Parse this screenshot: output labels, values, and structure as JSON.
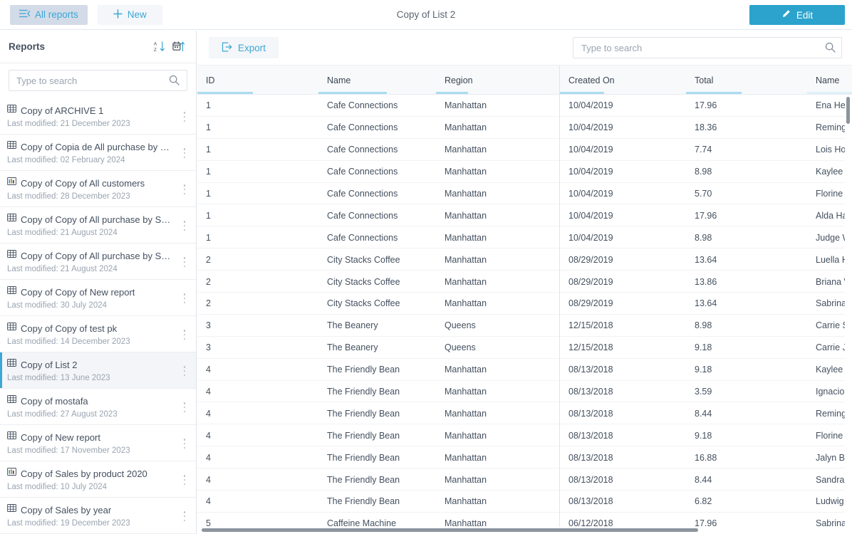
{
  "topbar": {
    "all_reports_label": "All reports",
    "new_label": "New",
    "title": "Copy of List 2",
    "edit_label": "Edit"
  },
  "sidebar": {
    "title": "Reports",
    "sort_alpha_icon": "sort-alpha-desc-icon",
    "sort_date_icon": "sort-date-asc-icon",
    "search_placeholder": "Type to search",
    "search_value": "",
    "modified_prefix": "Last modified:",
    "items": [
      {
        "icon": "table-report-icon",
        "name": "Copy of ARCHIVE 1",
        "modified": "Last modified: 21 December 2023",
        "selected": false
      },
      {
        "icon": "table-report-icon",
        "name": "Copy of Copia de All purchase by Sa…",
        "modified": "Last modified: 02 February 2024",
        "selected": false
      },
      {
        "icon": "chart-report-icon",
        "name": "Copy of Copy of All customers",
        "modified": "Last modified: 28 December 2023",
        "selected": false
      },
      {
        "icon": "table-report-icon",
        "name": "Copy of Copy of All purchase by San…",
        "modified": "Last modified: 21 August 2024",
        "selected": false
      },
      {
        "icon": "table-report-icon",
        "name": "Copy of Copy of All purchase by San…",
        "modified": "Last modified: 21 August 2024",
        "selected": false
      },
      {
        "icon": "table-report-icon",
        "name": "Copy of Copy of New report",
        "modified": "Last modified: 30 July 2024",
        "selected": false
      },
      {
        "icon": "table-report-icon",
        "name": "Copy of Copy of test pk",
        "modified": "Last modified: 14 December 2023",
        "selected": false
      },
      {
        "icon": "table-report-icon",
        "name": "Copy of List 2",
        "modified": "Last modified: 13 June 2023",
        "selected": true
      },
      {
        "icon": "table-report-icon",
        "name": "Copy of mostafa",
        "modified": "Last modified: 27 August 2023",
        "selected": false
      },
      {
        "icon": "table-report-icon",
        "name": "Copy of New report",
        "modified": "Last modified: 17 November 2023",
        "selected": false
      },
      {
        "icon": "chart-report-icon",
        "name": "Copy of Sales by product 2020",
        "modified": "Last modified: 10 July 2024",
        "selected": false
      },
      {
        "icon": "table-report-icon",
        "name": "Copy of Sales by year",
        "modified": "Last modified: 19 December 2023",
        "selected": false
      }
    ]
  },
  "main": {
    "export_label": "Export",
    "search_placeholder": "Type to search",
    "search_value": "",
    "columns": [
      "ID",
      "Name",
      "Region",
      "Created On",
      "Total",
      "Name"
    ],
    "rows": [
      {
        "id": "1",
        "name": "Cafe Connections",
        "region": "Manhattan",
        "created_on": "10/04/2019",
        "total": "17.96",
        "name2": "Ena Herm"
      },
      {
        "id": "1",
        "name": "Cafe Connections",
        "region": "Manhattan",
        "created_on": "10/04/2019",
        "total": "18.36",
        "name2": "Remingto"
      },
      {
        "id": "1",
        "name": "Cafe Connections",
        "region": "Manhattan",
        "created_on": "10/04/2019",
        "total": "7.74",
        "name2": "Lois How"
      },
      {
        "id": "1",
        "name": "Cafe Connections",
        "region": "Manhattan",
        "created_on": "10/04/2019",
        "total": "8.98",
        "name2": "Kaylee Fe"
      },
      {
        "id": "1",
        "name": "Cafe Connections",
        "region": "Manhattan",
        "created_on": "10/04/2019",
        "total": "5.70",
        "name2": "Florine Ro"
      },
      {
        "id": "1",
        "name": "Cafe Connections",
        "region": "Manhattan",
        "created_on": "10/04/2019",
        "total": "17.96",
        "name2": "Alda Hane"
      },
      {
        "id": "1",
        "name": "Cafe Connections",
        "region": "Manhattan",
        "created_on": "10/04/2019",
        "total": "8.98",
        "name2": "Judge Wil"
      },
      {
        "id": "2",
        "name": "City Stacks Coffee",
        "region": "Manhattan",
        "created_on": "08/29/2019",
        "total": "13.64",
        "name2": "Luella Ha"
      },
      {
        "id": "2",
        "name": "City Stacks Coffee",
        "region": "Manhattan",
        "created_on": "08/29/2019",
        "total": "13.86",
        "name2": "Briana Wi"
      },
      {
        "id": "2",
        "name": "City Stacks Coffee",
        "region": "Manhattan",
        "created_on": "08/29/2019",
        "total": "13.64",
        "name2": "Sabrina H"
      },
      {
        "id": "3",
        "name": "The Beanery",
        "region": "Queens",
        "created_on": "12/15/2018",
        "total": "8.98",
        "name2": "Carrie Sip"
      },
      {
        "id": "3",
        "name": "The Beanery",
        "region": "Queens",
        "created_on": "12/15/2018",
        "total": "9.18",
        "name2": "Carrie Jak"
      },
      {
        "id": "4",
        "name": "The Friendly Bean",
        "region": "Manhattan",
        "created_on": "08/13/2018",
        "total": "9.18",
        "name2": "Kaylee Ha"
      },
      {
        "id": "4",
        "name": "The Friendly Bean",
        "region": "Manhattan",
        "created_on": "08/13/2018",
        "total": "3.59",
        "name2": "Ignacio H"
      },
      {
        "id": "4",
        "name": "The Friendly Bean",
        "region": "Manhattan",
        "created_on": "08/13/2018",
        "total": "8.44",
        "name2": "Remingto"
      },
      {
        "id": "4",
        "name": "The Friendly Bean",
        "region": "Manhattan",
        "created_on": "08/13/2018",
        "total": "9.18",
        "name2": "Florine St"
      },
      {
        "id": "4",
        "name": "The Friendly Bean",
        "region": "Manhattan",
        "created_on": "08/13/2018",
        "total": "16.88",
        "name2": "Jalyn Brad"
      },
      {
        "id": "4",
        "name": "The Friendly Bean",
        "region": "Manhattan",
        "created_on": "08/13/2018",
        "total": "8.44",
        "name2": "Sandra Ra"
      },
      {
        "id": "4",
        "name": "The Friendly Bean",
        "region": "Manhattan",
        "created_on": "08/13/2018",
        "total": "6.82",
        "name2": "Ludwig Du"
      },
      {
        "id": "5",
        "name": "Caffeine Machine",
        "region": "Manhattan",
        "created_on": "06/12/2018",
        "total": "17.96",
        "name2": "Sabrina H"
      }
    ]
  },
  "colors": {
    "accent": "#2ba3cc",
    "link": "#3ba7d4",
    "text": "#44505f",
    "muted": "#9aa4b1",
    "header_bg": "#f7f9fb",
    "selected_bg": "#f3f5f8"
  }
}
